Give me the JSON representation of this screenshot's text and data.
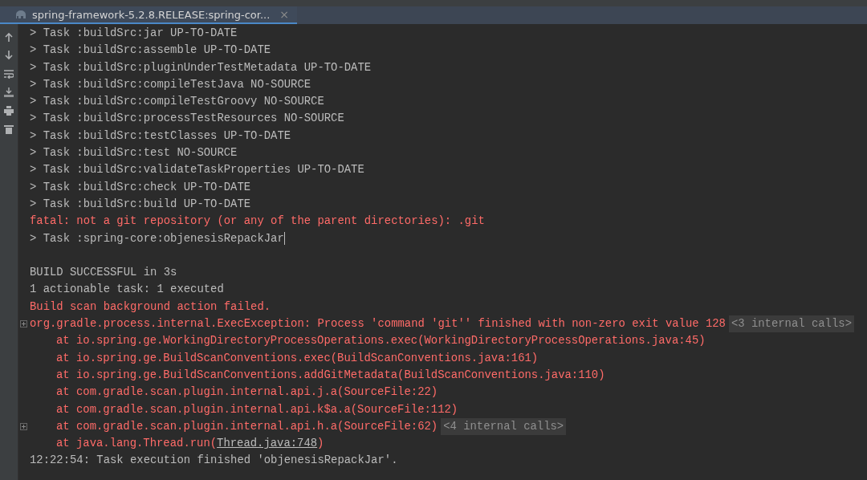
{
  "tab": {
    "title": "spring-framework-5.2.8.RELEASE:spring-cor...",
    "close": "×",
    "selected": true
  },
  "console": {
    "lines": [
      {
        "kind": "info",
        "text": "> Task :buildSrc:jar UP-TO-DATE"
      },
      {
        "kind": "info",
        "text": "> Task :buildSrc:assemble UP-TO-DATE"
      },
      {
        "kind": "info",
        "text": "> Task :buildSrc:pluginUnderTestMetadata UP-TO-DATE"
      },
      {
        "kind": "info",
        "text": "> Task :buildSrc:compileTestJava NO-SOURCE"
      },
      {
        "kind": "info",
        "text": "> Task :buildSrc:compileTestGroovy NO-SOURCE"
      },
      {
        "kind": "info",
        "text": "> Task :buildSrc:processTestResources NO-SOURCE"
      },
      {
        "kind": "info",
        "text": "> Task :buildSrc:testClasses UP-TO-DATE"
      },
      {
        "kind": "info",
        "text": "> Task :buildSrc:test NO-SOURCE"
      },
      {
        "kind": "info",
        "text": "> Task :buildSrc:validateTaskProperties UP-TO-DATE"
      },
      {
        "kind": "info",
        "text": "> Task :buildSrc:check UP-TO-DATE"
      },
      {
        "kind": "info",
        "text": "> Task :buildSrc:build UP-TO-DATE"
      },
      {
        "kind": "error",
        "text": "fatal: not a git repository (or any of the parent directories): .git"
      },
      {
        "kind": "info",
        "text": "> Task :spring-core:objenesisRepackJar",
        "cursor": true
      },
      {
        "kind": "blank"
      },
      {
        "kind": "info",
        "text": "BUILD SUCCESSFUL in 3s"
      },
      {
        "kind": "info",
        "text": "1 actionable task: 1 executed"
      },
      {
        "kind": "error",
        "text": "Build scan background action failed."
      },
      {
        "kind": "error",
        "text": "org.gradle.process.internal.ExecException: Process 'command 'git'' finished with non-zero exit value 128",
        "fold": true,
        "calls": "<3 internal calls>"
      },
      {
        "kind": "stack",
        "text": "at io.spring.ge.WorkingDirectoryProcessOperations.exec(WorkingDirectoryProcessOperations.java:45)"
      },
      {
        "kind": "stack",
        "text": "at io.spring.ge.BuildScanConventions.exec(BuildScanConventions.java:161)"
      },
      {
        "kind": "stack",
        "text": "at io.spring.ge.BuildScanConventions.addGitMetadata(BuildScanConventions.java:110)"
      },
      {
        "kind": "stack",
        "text": "at com.gradle.scan.plugin.internal.api.j.a(SourceFile:22)"
      },
      {
        "kind": "stack",
        "text": "at com.gradle.scan.plugin.internal.api.k$a.a(SourceFile:112)"
      },
      {
        "kind": "stack",
        "text": "at com.gradle.scan.plugin.internal.api.h.a(SourceFile:62)",
        "fold": true,
        "calls": "<4 internal calls>"
      },
      {
        "kind": "stack",
        "text": "at java.lang.Thread.run(",
        "link": "Thread.java:748",
        "after": ")"
      },
      {
        "kind": "info",
        "text": "12:22:54: Task execution finished 'objenesisRepackJar'."
      }
    ]
  }
}
